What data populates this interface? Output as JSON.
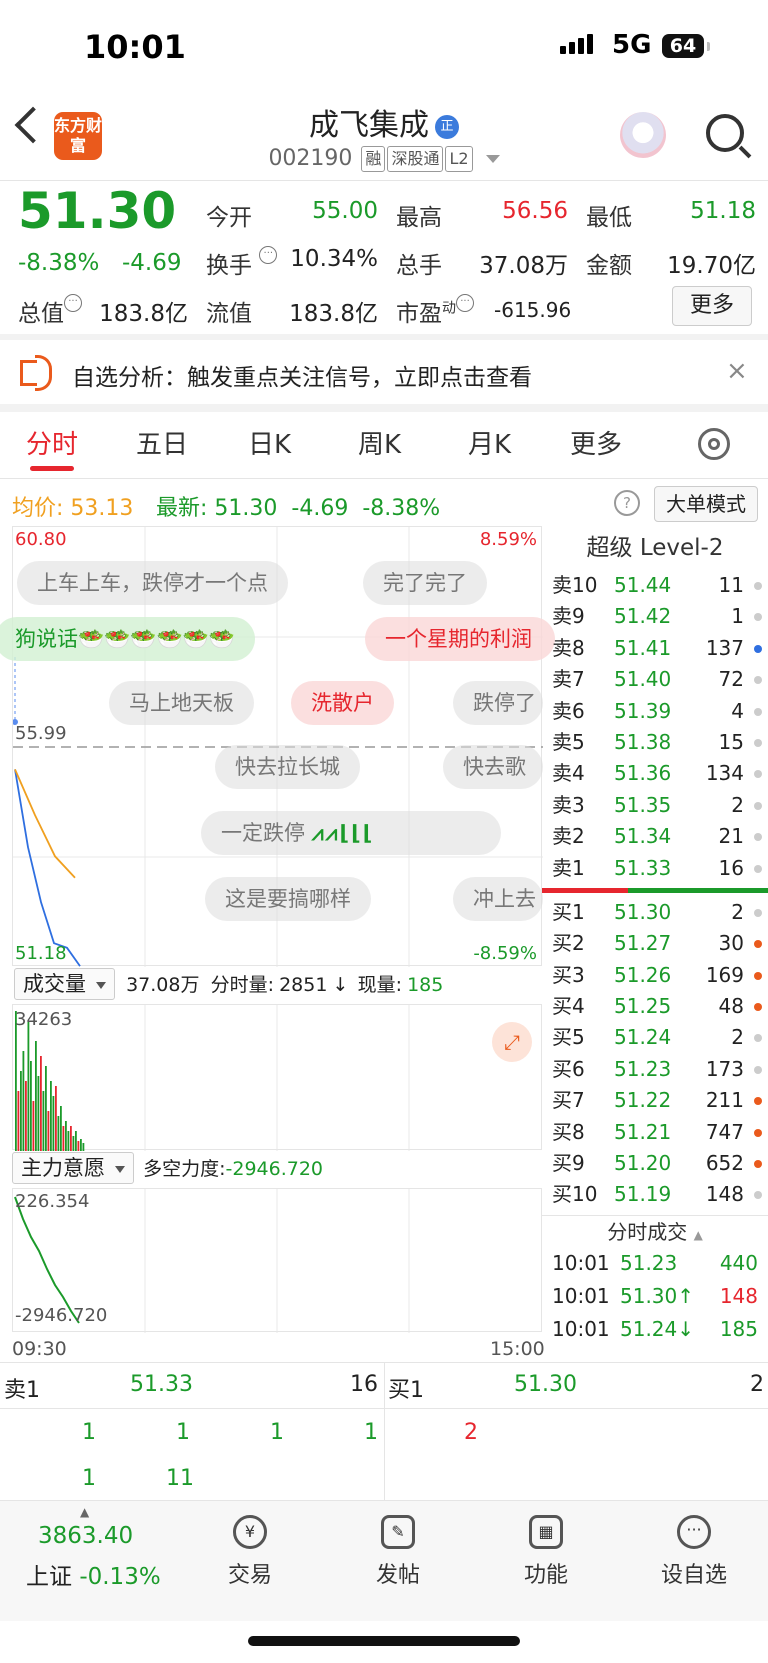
{
  "status_bar": {
    "time": "10:01",
    "network": "5G",
    "battery": "64"
  },
  "header": {
    "logo_text": "东方财富",
    "title": "成飞集成",
    "title_badge": "正",
    "code": "002190",
    "tags": [
      "融",
      "深股通",
      "L2"
    ]
  },
  "quote": {
    "price": "51.30",
    "change_pct": "-8.38%",
    "change": "-4.69",
    "open_label": "今开",
    "open": "55.00",
    "high_label": "最高",
    "high": "56.56",
    "low_label": "最低",
    "low": "51.18",
    "turnover_label": "换手",
    "turnover": "10.34%",
    "volume_label": "总手",
    "volume": "37.08万",
    "amount_label": "金额",
    "amount": "19.70亿",
    "mktcap_label": "总值",
    "mktcap": "183.8亿",
    "float_label": "流值",
    "float": "183.8亿",
    "pe_label": "市盈",
    "pe_sup": "动",
    "pe": "-615.96",
    "more_label": "更多"
  },
  "alert": {
    "text": "自选分析：触发重点关注信号，立即点击查看",
    "close": "×"
  },
  "tabs": [
    "分时",
    "五日",
    "日K",
    "周K",
    "月K",
    "更多"
  ],
  "info": {
    "avg_label": "均价:",
    "avg": "53.13",
    "latest_label": "最新:",
    "latest": "51.30",
    "change": "-4.69",
    "change_pct": "-8.38%",
    "help": "?",
    "mode_button": "大单模式"
  },
  "chart": {
    "top_left": "60.80",
    "top_right": "8.59%",
    "mid_left": "55.99",
    "bottom_left": "51.18",
    "bottom_right": "-8.59%",
    "danmu": [
      "上车上车，跌停才一个点",
      "完了完了",
      "狗说话🥗🥗🥗🥗🥗🥗",
      "一个星期的利润",
      "马上地天板",
      "洗散户",
      "跌停了",
      "快去拉长城",
      "快去歌",
      "一定跌停",
      "这是要搞哪样",
      "冲上去"
    ],
    "chart_data": {
      "type": "line",
      "series": [
        {
          "values": [
            55.5,
            53.8,
            52.6,
            51.7,
            51.6,
            51.2
          ]
        },
        {
          "values": [
            55.5,
            54.5,
            53.6,
            53.13
          ]
        }
      ],
      "ylim": [
        51.18,
        60.8
      ]
    }
  },
  "volume": {
    "selector": "成交量",
    "total": "37.08万",
    "fenshi_label": "分时量:",
    "fenshi": "2851",
    "arrow": "↓",
    "now_label": "现量:",
    "now": "185",
    "max": "34263"
  },
  "mainforce": {
    "selector": "主力意愿",
    "power_label": "多空力度:",
    "power": "-2946.720",
    "top": "226.354",
    "bottom": "-2946.720",
    "start_time": "09:30",
    "end_time": "15:00"
  },
  "orderbook": {
    "title": "超级 Level-2",
    "asks": [
      {
        "label": "卖10",
        "price": "51.44",
        "vol": "11",
        "dot": "#cccccc"
      },
      {
        "label": "卖9",
        "price": "51.42",
        "vol": "1",
        "dot": "#cccccc"
      },
      {
        "label": "卖8",
        "price": "51.41",
        "vol": "137",
        "dot": "#2f6fe0"
      },
      {
        "label": "卖7",
        "price": "51.40",
        "vol": "72",
        "dot": "#cccccc"
      },
      {
        "label": "卖6",
        "price": "51.39",
        "vol": "4",
        "dot": "#cccccc"
      },
      {
        "label": "卖5",
        "price": "51.38",
        "vol": "15",
        "dot": "#cccccc"
      },
      {
        "label": "卖4",
        "price": "51.36",
        "vol": "134",
        "dot": "#cccccc"
      },
      {
        "label": "卖3",
        "price": "51.35",
        "vol": "2",
        "dot": "#cccccc"
      },
      {
        "label": "卖2",
        "price": "51.34",
        "vol": "21",
        "dot": "#cccccc"
      },
      {
        "label": "卖1",
        "price": "51.33",
        "vol": "16",
        "dot": "#cccccc"
      }
    ],
    "bids": [
      {
        "label": "买1",
        "price": "51.30",
        "vol": "2",
        "dot": "#cccccc"
      },
      {
        "label": "买2",
        "price": "51.27",
        "vol": "30",
        "dot": "#ea5a1c"
      },
      {
        "label": "买3",
        "price": "51.26",
        "vol": "169",
        "dot": "#ea5a1c"
      },
      {
        "label": "买4",
        "price": "51.25",
        "vol": "48",
        "dot": "#ea5a1c"
      },
      {
        "label": "买5",
        "price": "51.24",
        "vol": "2",
        "dot": "#cccccc"
      },
      {
        "label": "买6",
        "price": "51.23",
        "vol": "173",
        "dot": "#cccccc"
      },
      {
        "label": "买7",
        "price": "51.22",
        "vol": "211",
        "dot": "#ea5a1c"
      },
      {
        "label": "买8",
        "price": "51.21",
        "vol": "747",
        "dot": "#ea5a1c"
      },
      {
        "label": "买9",
        "price": "51.20",
        "vol": "652",
        "dot": "#ea5a1c"
      },
      {
        "label": "买10",
        "price": "51.19",
        "vol": "148",
        "dot": "#cccccc"
      }
    ],
    "trades_title": "分时成交",
    "trades": [
      {
        "time": "10:01",
        "price": "51.23",
        "vol": "440"
      },
      {
        "time": "10:01",
        "price": "51.30↑",
        "vol": "148"
      },
      {
        "time": "10:01",
        "price": "51.24↓",
        "vol": "185"
      }
    ]
  },
  "bidask": {
    "sell_label": "卖1",
    "sell_price": "51.33",
    "sell_vol": "16",
    "buy_label": "买1",
    "buy_price": "51.30",
    "buy_vol": "2",
    "sell_queue": [
      "1",
      "1",
      "1",
      "1",
      "1",
      "11"
    ],
    "buy_queue": [
      "2"
    ]
  },
  "nav": {
    "index_value": "3863.40",
    "index_name": "上证",
    "index_change": "-0.13%",
    "items": [
      {
        "label": "交易",
        "icon": "¥"
      },
      {
        "label": "发帖",
        "icon": "✎"
      },
      {
        "label": "功能",
        "icon": "▦"
      },
      {
        "label": "设自选",
        "icon": "···"
      }
    ]
  },
  "colors": {
    "up": "#e6262e",
    "down": "#1b9a2a",
    "accent": "#ea5a1c",
    "avg_line": "#f0a020"
  }
}
